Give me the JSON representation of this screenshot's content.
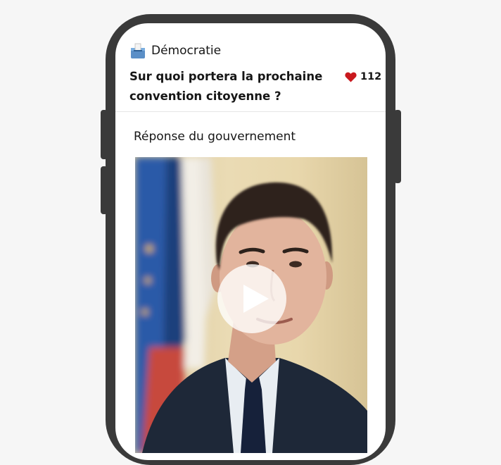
{
  "card": {
    "category_label": "Démocratie",
    "category_icon": "ballot-box-icon",
    "title": "Sur quoi portera la prochaine convention citoyenne ?",
    "likes_icon": "heart-icon",
    "likes_count": "112"
  },
  "response": {
    "label": "Réponse du gouvernement",
    "video_icon": "play-icon"
  },
  "colors": {
    "heart": "#c9191e",
    "text": "#161616",
    "phone_frame": "#3a3a3a",
    "background": "#f6f6f6"
  }
}
